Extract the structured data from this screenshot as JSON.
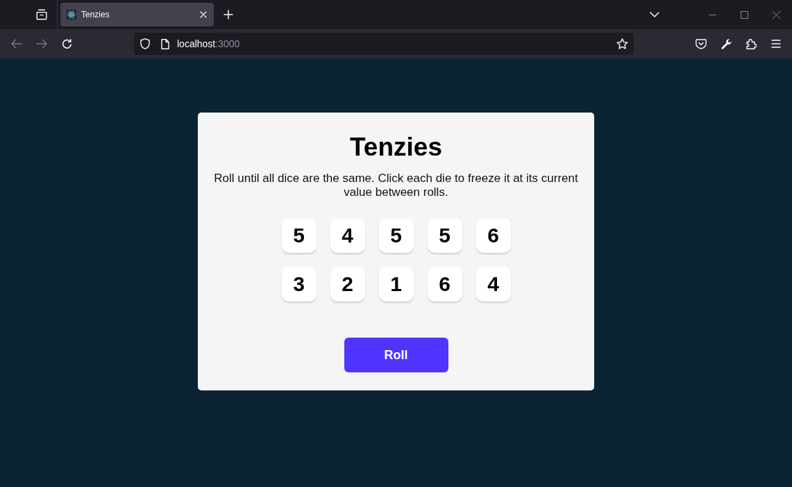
{
  "browser": {
    "tabs": [
      {
        "title": "Tenzies",
        "selected": true
      }
    ],
    "nav_buttons": [
      {
        "kind": "back",
        "disabled": true
      },
      {
        "kind": "forward",
        "disabled": true
      },
      {
        "kind": "reload",
        "disabled": false
      }
    ],
    "address": {
      "host": "localhost",
      "port": ":3000"
    }
  },
  "game": {
    "title": "Tenzies",
    "instructions": "Roll until all dice are the same. Click each die to freeze it at its current value between rolls.",
    "dice": [
      {
        "value": "5",
        "held": false
      },
      {
        "value": "4",
        "held": false
      },
      {
        "value": "5",
        "held": false
      },
      {
        "value": "5",
        "held": false
      },
      {
        "value": "6",
        "held": false
      },
      {
        "value": "3",
        "held": false
      },
      {
        "value": "2",
        "held": false
      },
      {
        "value": "1",
        "held": false
      },
      {
        "value": "6",
        "held": false
      },
      {
        "value": "4",
        "held": false
      }
    ],
    "roll_button": "Roll"
  }
}
